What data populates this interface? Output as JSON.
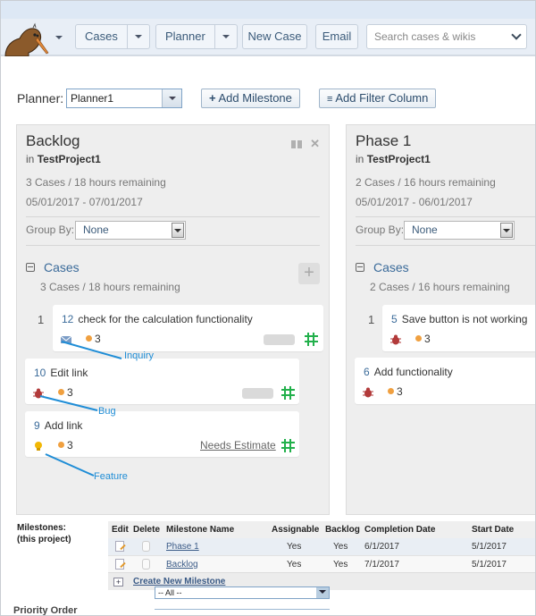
{
  "navbar": {
    "logo_name": "kiwi-logo",
    "cases_label": "Cases",
    "planner_label": "Planner",
    "new_case_label": "New Case",
    "email_label": "Email",
    "search_placeholder": "Search cases & wikis"
  },
  "toolbar": {
    "planner_label": "Planner:",
    "planner_value": "Planner1",
    "add_milestone_label": "Add Milestone",
    "add_filter_column_label": "Add Filter Column"
  },
  "columns": [
    {
      "title": "Backlog",
      "project_prefix": "in",
      "project": "TestProject1",
      "stats": "3 Cases / 18 hours remaining",
      "dates": "05/01/2017 - 07/01/2017",
      "group_by_label": "Group By:",
      "group_by_value": "None",
      "section_title": "Cases",
      "section_stats": "3 Cases / 18 hours remaining",
      "cards": [
        {
          "rank": "1",
          "number": "12",
          "title": "check for the calculation functionality",
          "type": "inquiry",
          "estimate": "3",
          "status": "pill"
        },
        {
          "rank": "",
          "number": "10",
          "title": "Edit link",
          "type": "bug",
          "estimate": "3",
          "status": "pill"
        },
        {
          "rank": "",
          "number": "9",
          "title": "Add link",
          "type": "feature",
          "estimate": "3",
          "status": "Needs Estimate"
        }
      ]
    },
    {
      "title": "Phase 1",
      "project_prefix": "in",
      "project": "TestProject1",
      "stats": "2 Cases / 16 hours remaining",
      "dates": "05/01/2017 - 06/01/2017",
      "group_by_label": "Group By:",
      "group_by_value": "None",
      "section_title": "Cases",
      "section_stats": "2 Cases / 16 hours remaining",
      "cards": [
        {
          "rank": "1",
          "number": "5",
          "title": "Save button is not working",
          "type": "bug",
          "estimate": "3"
        },
        {
          "rank": "",
          "number": "6",
          "title": "Add functionality",
          "type": "bug",
          "estimate": "3"
        }
      ]
    }
  ],
  "annotations": {
    "inquiry": "Inquiry",
    "bug": "Bug",
    "feature": "Feature",
    "color": "#1f8dd6"
  },
  "milestones": {
    "label_line1": "Milestones:",
    "label_line2": "(this project)",
    "headers": [
      "Edit",
      "Delete",
      "Milestone Name",
      "Assignable",
      "Backlog",
      "Completion Date",
      "Start Date"
    ],
    "rows": [
      {
        "name": "Phase 1",
        "assignable": "Yes",
        "backlog": "Yes",
        "completion": "6/1/2017",
        "start": "5/1/2017"
      },
      {
        "name": "Backlog",
        "assignable": "Yes",
        "backlog": "Yes",
        "completion": "7/1/2017",
        "start": "5/1/2017"
      }
    ],
    "create_label": "Create New Milestone",
    "filter_value": "-- All --",
    "priority_label": "Priority Order"
  },
  "colors": {
    "accent": "#3b6b9a",
    "estimate_dot": "#f0a040",
    "bug": "#b23a3a",
    "feature": "#f2b705",
    "inquiry": "#7a9cc6",
    "grid_icon": "#22b04b"
  }
}
